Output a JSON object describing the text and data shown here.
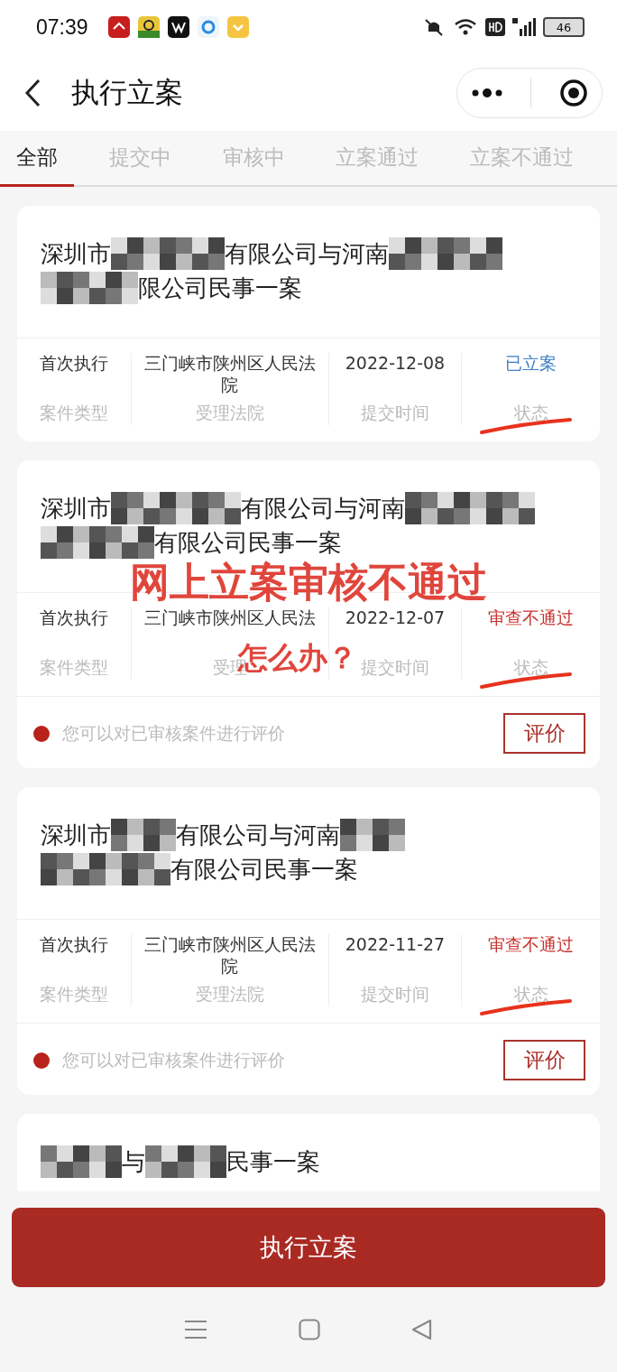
{
  "status_bar": {
    "time": "07:39",
    "battery": "46"
  },
  "nav": {
    "title": "执行立案"
  },
  "tabs": [
    {
      "label": "全部",
      "selected": true
    },
    {
      "label": "提交中",
      "selected": false
    },
    {
      "label": "审核中",
      "selected": false
    },
    {
      "label": "立案通过",
      "selected": false
    },
    {
      "label": "立案不通过",
      "selected": false
    }
  ],
  "cases": [
    {
      "title_lines": [
        [
          {
            "kind": "text",
            "text": "深圳市"
          },
          {
            "kind": "redacted"
          },
          {
            "kind": "text",
            "text": "有限公司与河南"
          },
          {
            "kind": "redacted"
          }
        ],
        [
          {
            "kind": "redacted"
          },
          {
            "kind": "text",
            "text": "限公司民事一案"
          }
        ]
      ],
      "fields": [
        {
          "value": "首次执行",
          "label": "案件类型"
        },
        {
          "value": "三门峡市陕州区人民法院",
          "label": "受理法院"
        },
        {
          "value": "2022-12-08",
          "label": "提交时间"
        },
        {
          "value": "已立案",
          "label": "状态",
          "kind": "status",
          "color": "#3f7fc6"
        }
      ],
      "underlined": true
    },
    {
      "title_lines": [
        [
          {
            "kind": "text",
            "text": "深圳市"
          },
          {
            "kind": "redacted"
          },
          {
            "kind": "text",
            "text": "有限公司与河南"
          },
          {
            "kind": "redacted"
          }
        ],
        [
          {
            "kind": "redacted"
          },
          {
            "kind": "text",
            "text": "有限公司民事一案"
          }
        ]
      ],
      "fields": [
        {
          "value": "首次执行",
          "label": "案件类型"
        },
        {
          "value": "三门峡市陕州区人民法",
          "label": "受理"
        },
        {
          "value": "2022-12-07",
          "label": "提交时间"
        },
        {
          "value": "审查不通过",
          "label": "状态",
          "kind": "status",
          "color": "#c9302c"
        }
      ],
      "underlined": true,
      "rating": {
        "hint": "您可以对已审核案件进行评价",
        "button": "评价"
      },
      "annotation": [
        "网上立案审核不通过",
        "怎么办？"
      ]
    },
    {
      "title_lines": [
        [
          {
            "kind": "text",
            "text": "深圳市"
          },
          {
            "kind": "redacted"
          },
          {
            "kind": "text",
            "text": "有限公司与河南"
          },
          {
            "kind": "redacted"
          }
        ],
        [
          {
            "kind": "redacted"
          },
          {
            "kind": "text",
            "text": "有限公司民事一案"
          }
        ]
      ],
      "fields": [
        {
          "value": "首次执行",
          "label": "案件类型"
        },
        {
          "value": "三门峡市陕州区人民法院",
          "label": "受理法院"
        },
        {
          "value": "2022-11-27",
          "label": "提交时间"
        },
        {
          "value": "审查不通过",
          "label": "状态",
          "kind": "status",
          "color": "#c9302c"
        }
      ],
      "underlined": true,
      "rating": {
        "hint": "您可以对已审核案件进行评价",
        "button": "评价"
      }
    },
    {
      "title_lines": [
        [
          {
            "kind": "redacted"
          },
          {
            "kind": "text",
            "text": "与"
          },
          {
            "kind": "redacted"
          },
          {
            "kind": "text",
            "text": "民事一案"
          }
        ]
      ]
    }
  ],
  "action_button": "执行立案"
}
